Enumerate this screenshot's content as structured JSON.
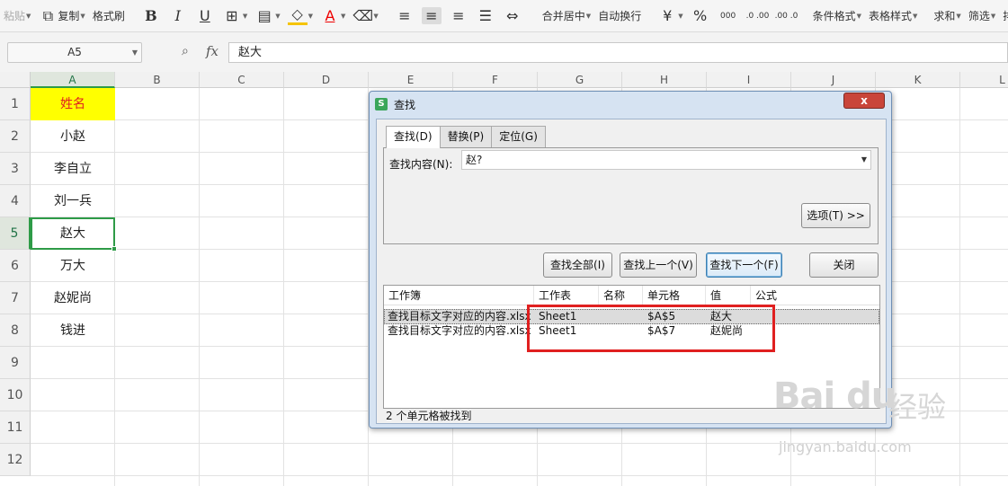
{
  "toolbar": {
    "paste": "粘贴",
    "copy": "复制",
    "format_painter": "格式刷",
    "bold": "B",
    "italic": "I",
    "underline": "U",
    "merge_center": "合并居中",
    "wrap_text": "自动换行",
    "percent": "%",
    "thousands": "000",
    "inc_decimal": ".0 .00",
    "dec_decimal": ".00 .0",
    "cond_format": "条件格式",
    "table_style": "表格样式",
    "sum": "求和",
    "filter": "筛选",
    "sort": "排"
  },
  "formula_bar": {
    "name_box": "A5",
    "fx_label": "fx",
    "content": "赵大"
  },
  "columns": [
    "A",
    "B",
    "C",
    "D",
    "E",
    "F",
    "G",
    "H",
    "I",
    "J",
    "K",
    "L"
  ],
  "rows": [
    "1",
    "2",
    "3",
    "4",
    "5",
    "6",
    "7",
    "8",
    "9",
    "10",
    "11",
    "12"
  ],
  "cells_a": [
    "姓名",
    "小赵",
    "李自立",
    "刘一兵",
    "赵大",
    "万大",
    "赵妮尚",
    "钱进"
  ],
  "dialog": {
    "title": "查找",
    "close": "x",
    "tabs": [
      "查找(D)",
      "替换(P)",
      "定位(G)"
    ],
    "find_label": "查找内容(N):",
    "find_value": "赵?",
    "options_button": "选项(T) >>",
    "find_all": "查找全部(I)",
    "find_prev": "查找上一个(V)",
    "find_next": "查找下一个(F)",
    "close_button": "关闭",
    "result_headers": [
      "工作簿",
      "工作表",
      "名称",
      "单元格",
      "值",
      "公式"
    ],
    "results": [
      {
        "workbook": "查找目标文字对应的内容.xlsx",
        "sheet": "Sheet1",
        "name": "",
        "cell": "$A$5",
        "value": "赵大",
        "formula": ""
      },
      {
        "workbook": "查找目标文字对应的内容.xlsx",
        "sheet": "Sheet1",
        "name": "",
        "cell": "$A$7",
        "value": "赵妮尚",
        "formula": ""
      }
    ],
    "status": "2 个单元格被找到"
  },
  "watermark": {
    "logo": "Bai du",
    "cn": "经验",
    "url": "jingyan.baidu.com"
  }
}
